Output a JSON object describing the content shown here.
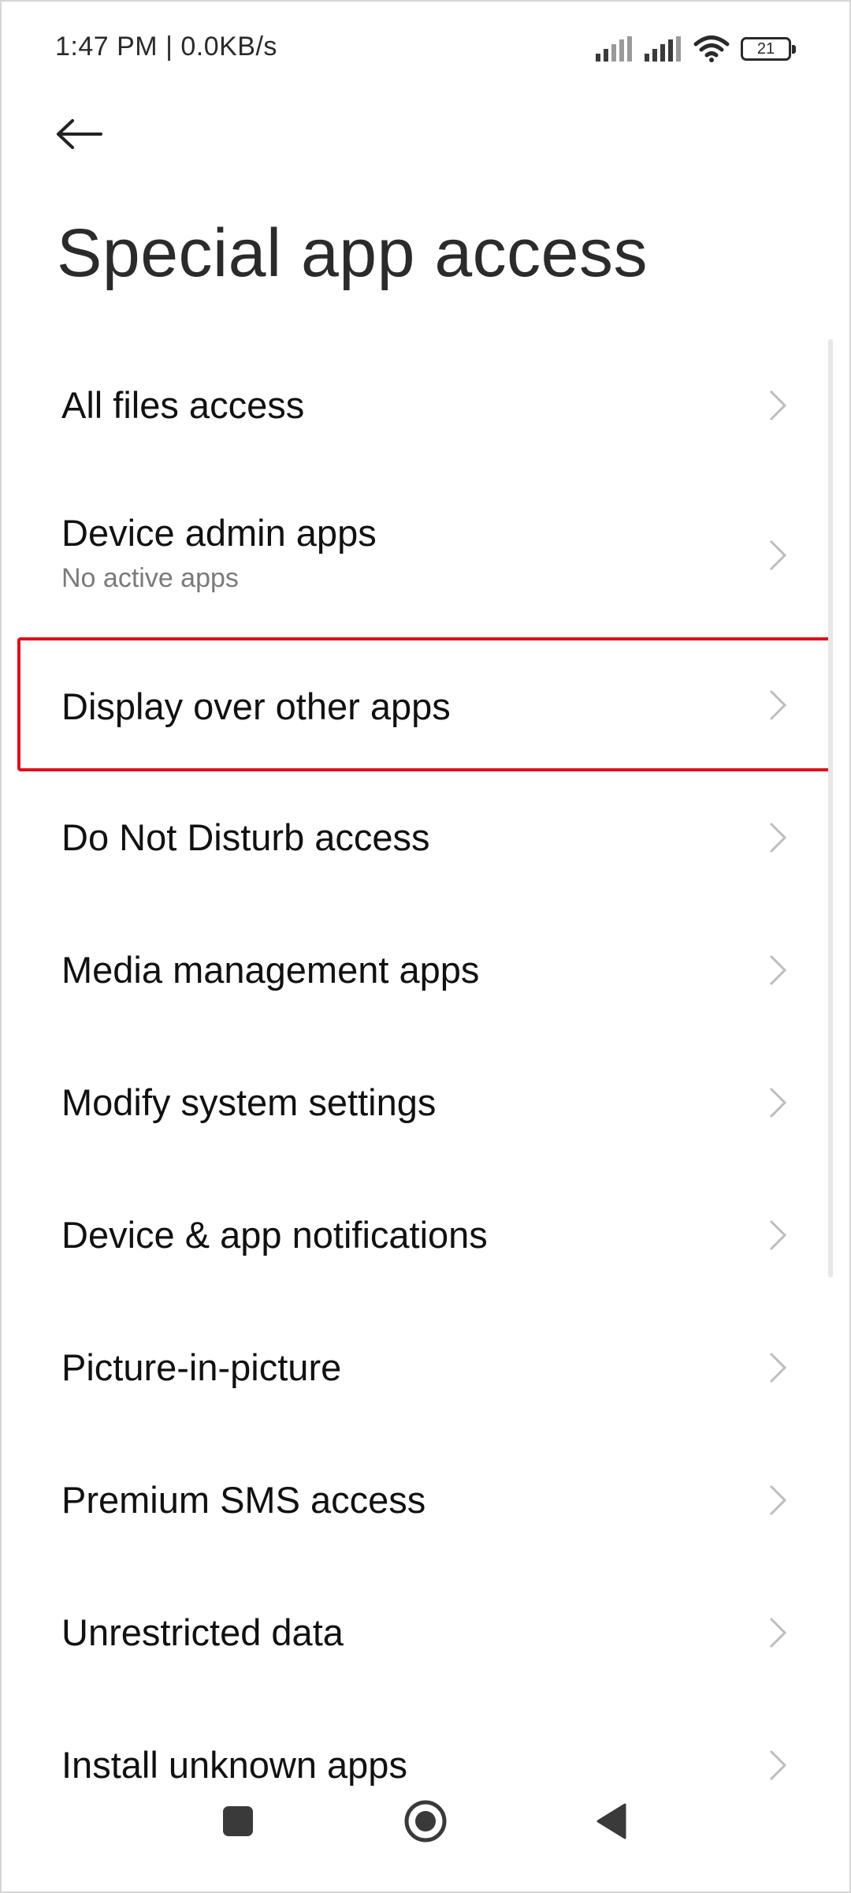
{
  "status_bar": {
    "time_text": "1:47 PM | 0.0KB/s",
    "battery_level": "21",
    "icons": [
      "signal-bars-icon",
      "signal-bars-icon",
      "wifi-icon",
      "battery-icon"
    ]
  },
  "header": {
    "back_icon": "arrow-left-icon",
    "title": "Special app access"
  },
  "list": {
    "items": [
      {
        "title": "All files access",
        "subtitle": ""
      },
      {
        "title": "Device admin apps",
        "subtitle": "No active apps"
      },
      {
        "title": "Display over other apps",
        "subtitle": "",
        "highlighted": true
      },
      {
        "title": "Do Not Disturb access",
        "subtitle": ""
      },
      {
        "title": "Media management apps",
        "subtitle": ""
      },
      {
        "title": "Modify system settings",
        "subtitle": ""
      },
      {
        "title": "Device & app notifications",
        "subtitle": ""
      },
      {
        "title": "Picture-in-picture",
        "subtitle": ""
      },
      {
        "title": "Premium SMS access",
        "subtitle": ""
      },
      {
        "title": "Unrestricted data",
        "subtitle": ""
      },
      {
        "title": "Install unknown apps",
        "subtitle": ""
      }
    ]
  },
  "nav_bar": {
    "icons": [
      "recents-square-icon",
      "home-circle-icon",
      "back-triangle-icon"
    ]
  },
  "colors": {
    "highlight_border": "#e0101a",
    "text_primary": "#111111",
    "text_secondary": "#7a7a7a",
    "chevron": "#bdbdbd"
  }
}
